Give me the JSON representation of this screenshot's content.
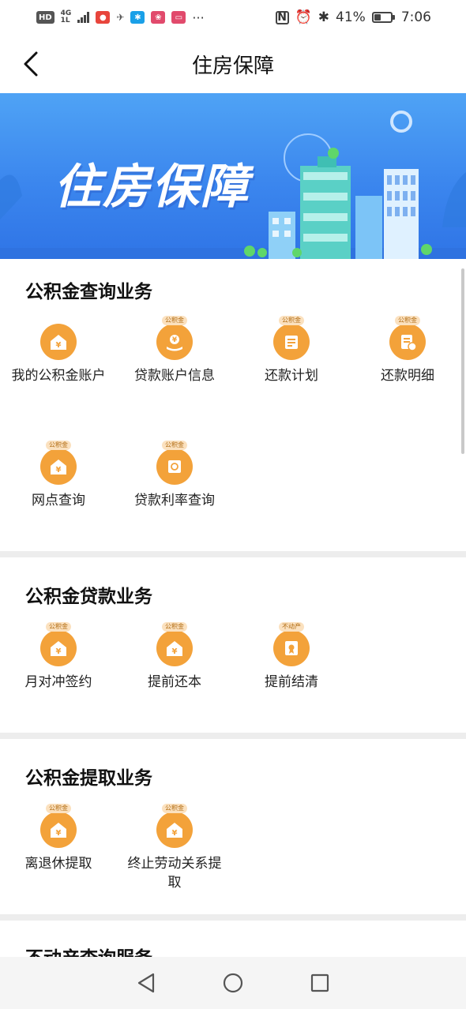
{
  "status_bar": {
    "hd": "HD",
    "network": "4G",
    "network_sub": "1L",
    "battery_percent": "41%",
    "time": "7:06",
    "more_dots": "···"
  },
  "header": {
    "title": "住房保障"
  },
  "banner": {
    "text": "住房保障"
  },
  "sections": [
    {
      "title": "公积金查询业务",
      "items": [
        {
          "label": "我的公积金账户",
          "icon": "house-yuan-icon"
        },
        {
          "label": "贷款账户信息",
          "icon": "hand-yuan-icon",
          "tag": "公积金"
        },
        {
          "label": "还款计划",
          "icon": "calendar-doc-icon",
          "tag": "公积金"
        },
        {
          "label": "还款明细",
          "icon": "doc-clock-icon",
          "tag": "公积金"
        },
        {
          "label": "网点查询",
          "icon": "house-yuan-icon",
          "tag": "公积金"
        },
        {
          "label": "贷款利率查询",
          "icon": "rate-icon",
          "tag": "公积金"
        }
      ]
    },
    {
      "title": "公积金贷款业务",
      "items": [
        {
          "label": "月对冲签约",
          "icon": "house-yuan-icon",
          "tag": "公积金"
        },
        {
          "label": "提前还本",
          "icon": "house-yuan-icon",
          "tag": "公积金"
        },
        {
          "label": "提前结清",
          "icon": "certificate-icon",
          "tag": "不动产"
        }
      ]
    },
    {
      "title": "公积金提取业务",
      "items": [
        {
          "label": "离退休提取",
          "icon": "house-yuan-icon",
          "tag": "公积金"
        },
        {
          "label": "终止劳动关系提取",
          "icon": "house-yuan-icon",
          "tag": "公积金"
        }
      ]
    },
    {
      "title": "不动产查询服务",
      "items": []
    }
  ],
  "colors": {
    "accent": "#f3a23a",
    "banner_blue": "#3b86ee"
  }
}
